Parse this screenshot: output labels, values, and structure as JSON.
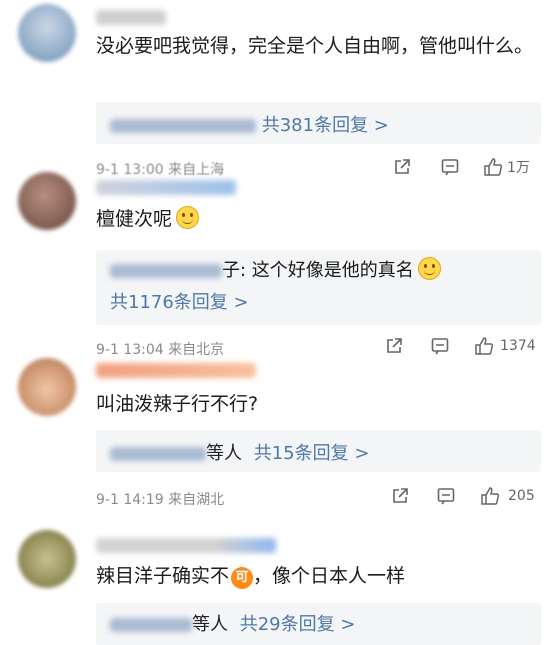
{
  "comments": [
    {
      "text": "没必要吧我觉得，完全是个人自由啊，管他叫什么。",
      "reply_suffix": "共381条回复 >"
    },
    {
      "meta": "9-1 13:00 来自上海",
      "likes": "1万",
      "text": "檀健次呢",
      "reply_line1": "子: 这个好像是他的真名",
      "reply_count": "共1176条回复 >"
    },
    {
      "meta": "9-1 13:04 来自北京",
      "likes": "1374",
      "text": "叫油泼辣子行不行?",
      "reply_pre": "等人",
      "reply_count": "共15条回复 >"
    },
    {
      "meta": "9-1 14:19 来自湖北",
      "likes": "205",
      "text_a": "辣目洋子确实不",
      "badge": "可",
      "text_b": "，像个日本人一样",
      "reply_pre": "等人",
      "reply_count": "共29条回复 >"
    }
  ],
  "colors": {
    "link": "#4f78a8",
    "meta": "#8a8a8a",
    "reply_bg": "#f4f5f7"
  },
  "icons": [
    "share-icon",
    "comment-icon",
    "like-icon",
    "smile-emoji"
  ]
}
